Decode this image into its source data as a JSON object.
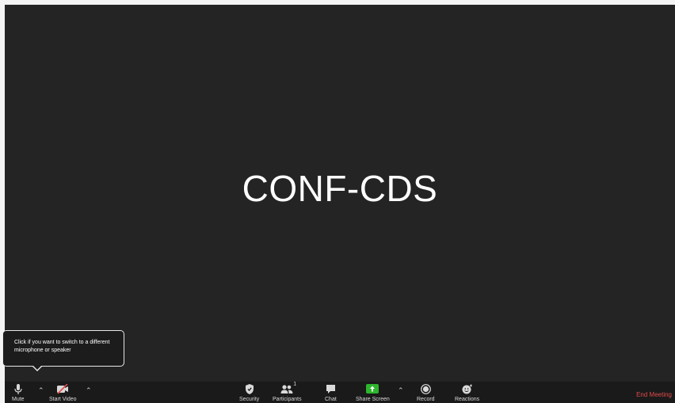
{
  "meeting": {
    "name": "CONF-CDS"
  },
  "tooltip": {
    "text": "Click if you want to switch to a different microphone or speaker"
  },
  "toolbar": {
    "mute_label": "Mute",
    "start_video_label": "Start Video",
    "security_label": "Security",
    "participants_label": "Participants",
    "participants_count": "1",
    "chat_label": "Chat",
    "share_screen_label": "Share Screen",
    "record_label": "Record",
    "reactions_label": "Reactions",
    "end_meeting_label": "End Meeting"
  },
  "icons": {
    "mute": "microphone-icon",
    "video": "video-off-icon",
    "security": "shield-icon",
    "participants": "people-icon",
    "chat": "chat-bubble-icon",
    "share": "share-screen-icon",
    "record": "record-icon",
    "reactions": "emoji-icon"
  },
  "colors": {
    "background": "#242424",
    "share_accent": "#2db52d",
    "video_off": "#e24a4a",
    "end_meeting": "#e24a4a"
  }
}
